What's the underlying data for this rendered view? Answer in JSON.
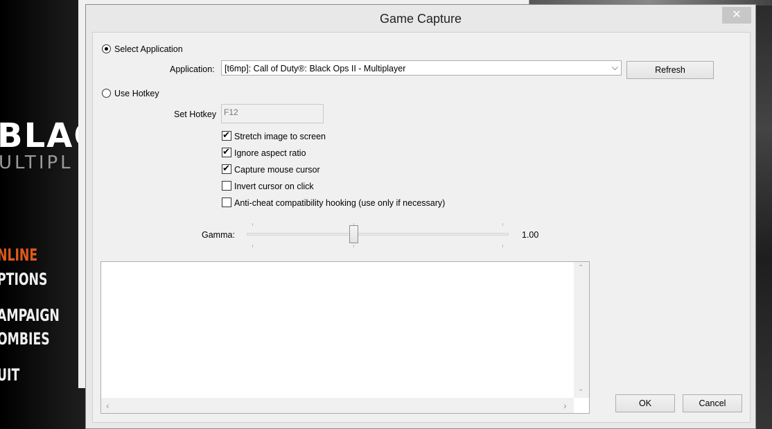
{
  "background_game": {
    "logo": "BLAC",
    "subtitle": "ULTIPL",
    "menu": [
      {
        "label": "NLINE",
        "active": true
      },
      {
        "label": "PTIONS",
        "active": false
      },
      {
        "label": "AMPAIGN",
        "active": false
      },
      {
        "label": "OMBIES",
        "active": false
      },
      {
        "label": "UIT",
        "active": false
      }
    ]
  },
  "dialog": {
    "title": "Game Capture",
    "close_glyph": "✕",
    "select_application": {
      "label": "Select Application",
      "selected": true
    },
    "application": {
      "label": "Application:",
      "value": "[t6mp]: Call of Duty®: Black Ops II - Multiplayer"
    },
    "refresh_label": "Refresh",
    "use_hotkey": {
      "label": "Use Hotkey",
      "selected": false
    },
    "set_hotkey": {
      "label": "Set Hotkey",
      "value": "F12"
    },
    "options": [
      {
        "label": "Stretch image to screen",
        "checked": true
      },
      {
        "label": "Ignore aspect ratio",
        "checked": true
      },
      {
        "label": "Capture mouse cursor",
        "checked": true
      },
      {
        "label": "Invert cursor on click",
        "checked": false
      },
      {
        "label": "Anti-cheat compatibility hooking (use only if necessary)",
        "checked": false
      }
    ],
    "gamma": {
      "label": "Gamma:",
      "value_text": "1.00",
      "fraction": 0.41
    },
    "ok_label": "OK",
    "cancel_label": "Cancel"
  },
  "icons": {
    "checkmark": "✔",
    "chevron_down": "⌵",
    "scroll_up": "⌃",
    "scroll_down": "⌄",
    "scroll_left": "‹",
    "scroll_right": "›"
  }
}
